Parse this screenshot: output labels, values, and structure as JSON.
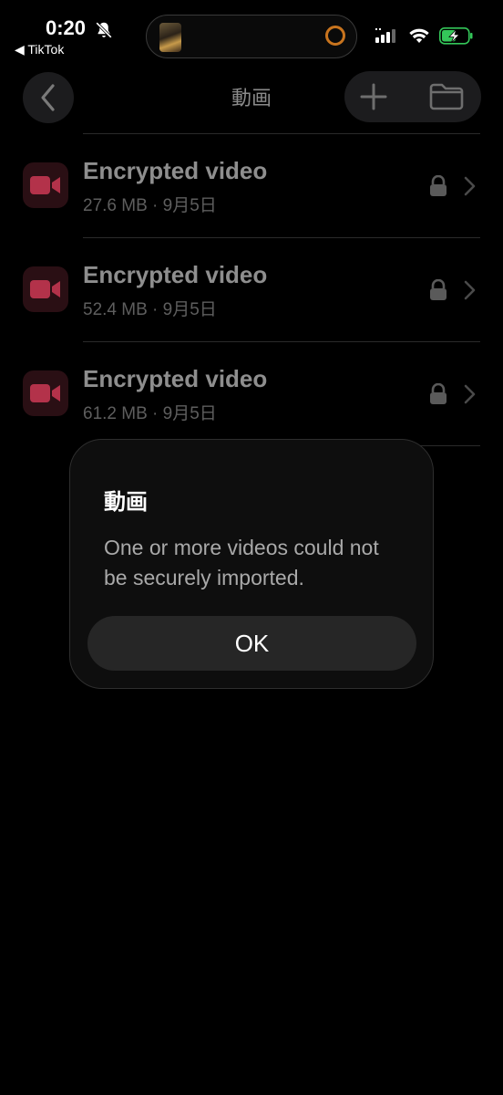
{
  "status_bar": {
    "time": "0:20",
    "back_app": "◀ TikTok",
    "icons": [
      "bell-slash-icon",
      "cellular-icon",
      "wifi-icon",
      "battery-charging-icon"
    ]
  },
  "header": {
    "title": "動画",
    "left_icon": "chevron-left-icon",
    "right_icons": [
      "plus-icon",
      "folder-icon"
    ]
  },
  "list": {
    "items": [
      {
        "title": "Encrypted video",
        "subtitle": "27.6 MB · 9月5日",
        "icon": "video-camera-icon",
        "locked": true
      },
      {
        "title": "Encrypted video",
        "subtitle": "52.4 MB · 9月5日",
        "icon": "video-camera-icon",
        "locked": true
      },
      {
        "title": "Encrypted video",
        "subtitle": "61.2 MB · 9月5日",
        "icon": "video-camera-icon",
        "locked": true
      }
    ]
  },
  "dialog": {
    "title": "動画",
    "message": "One or more videos could not be securely imported.",
    "ok_label": "OK"
  },
  "colors": {
    "background": "#000000",
    "video_icon": "#b3324a",
    "battery": "#34c759",
    "island_ring": "#c8741e"
  }
}
